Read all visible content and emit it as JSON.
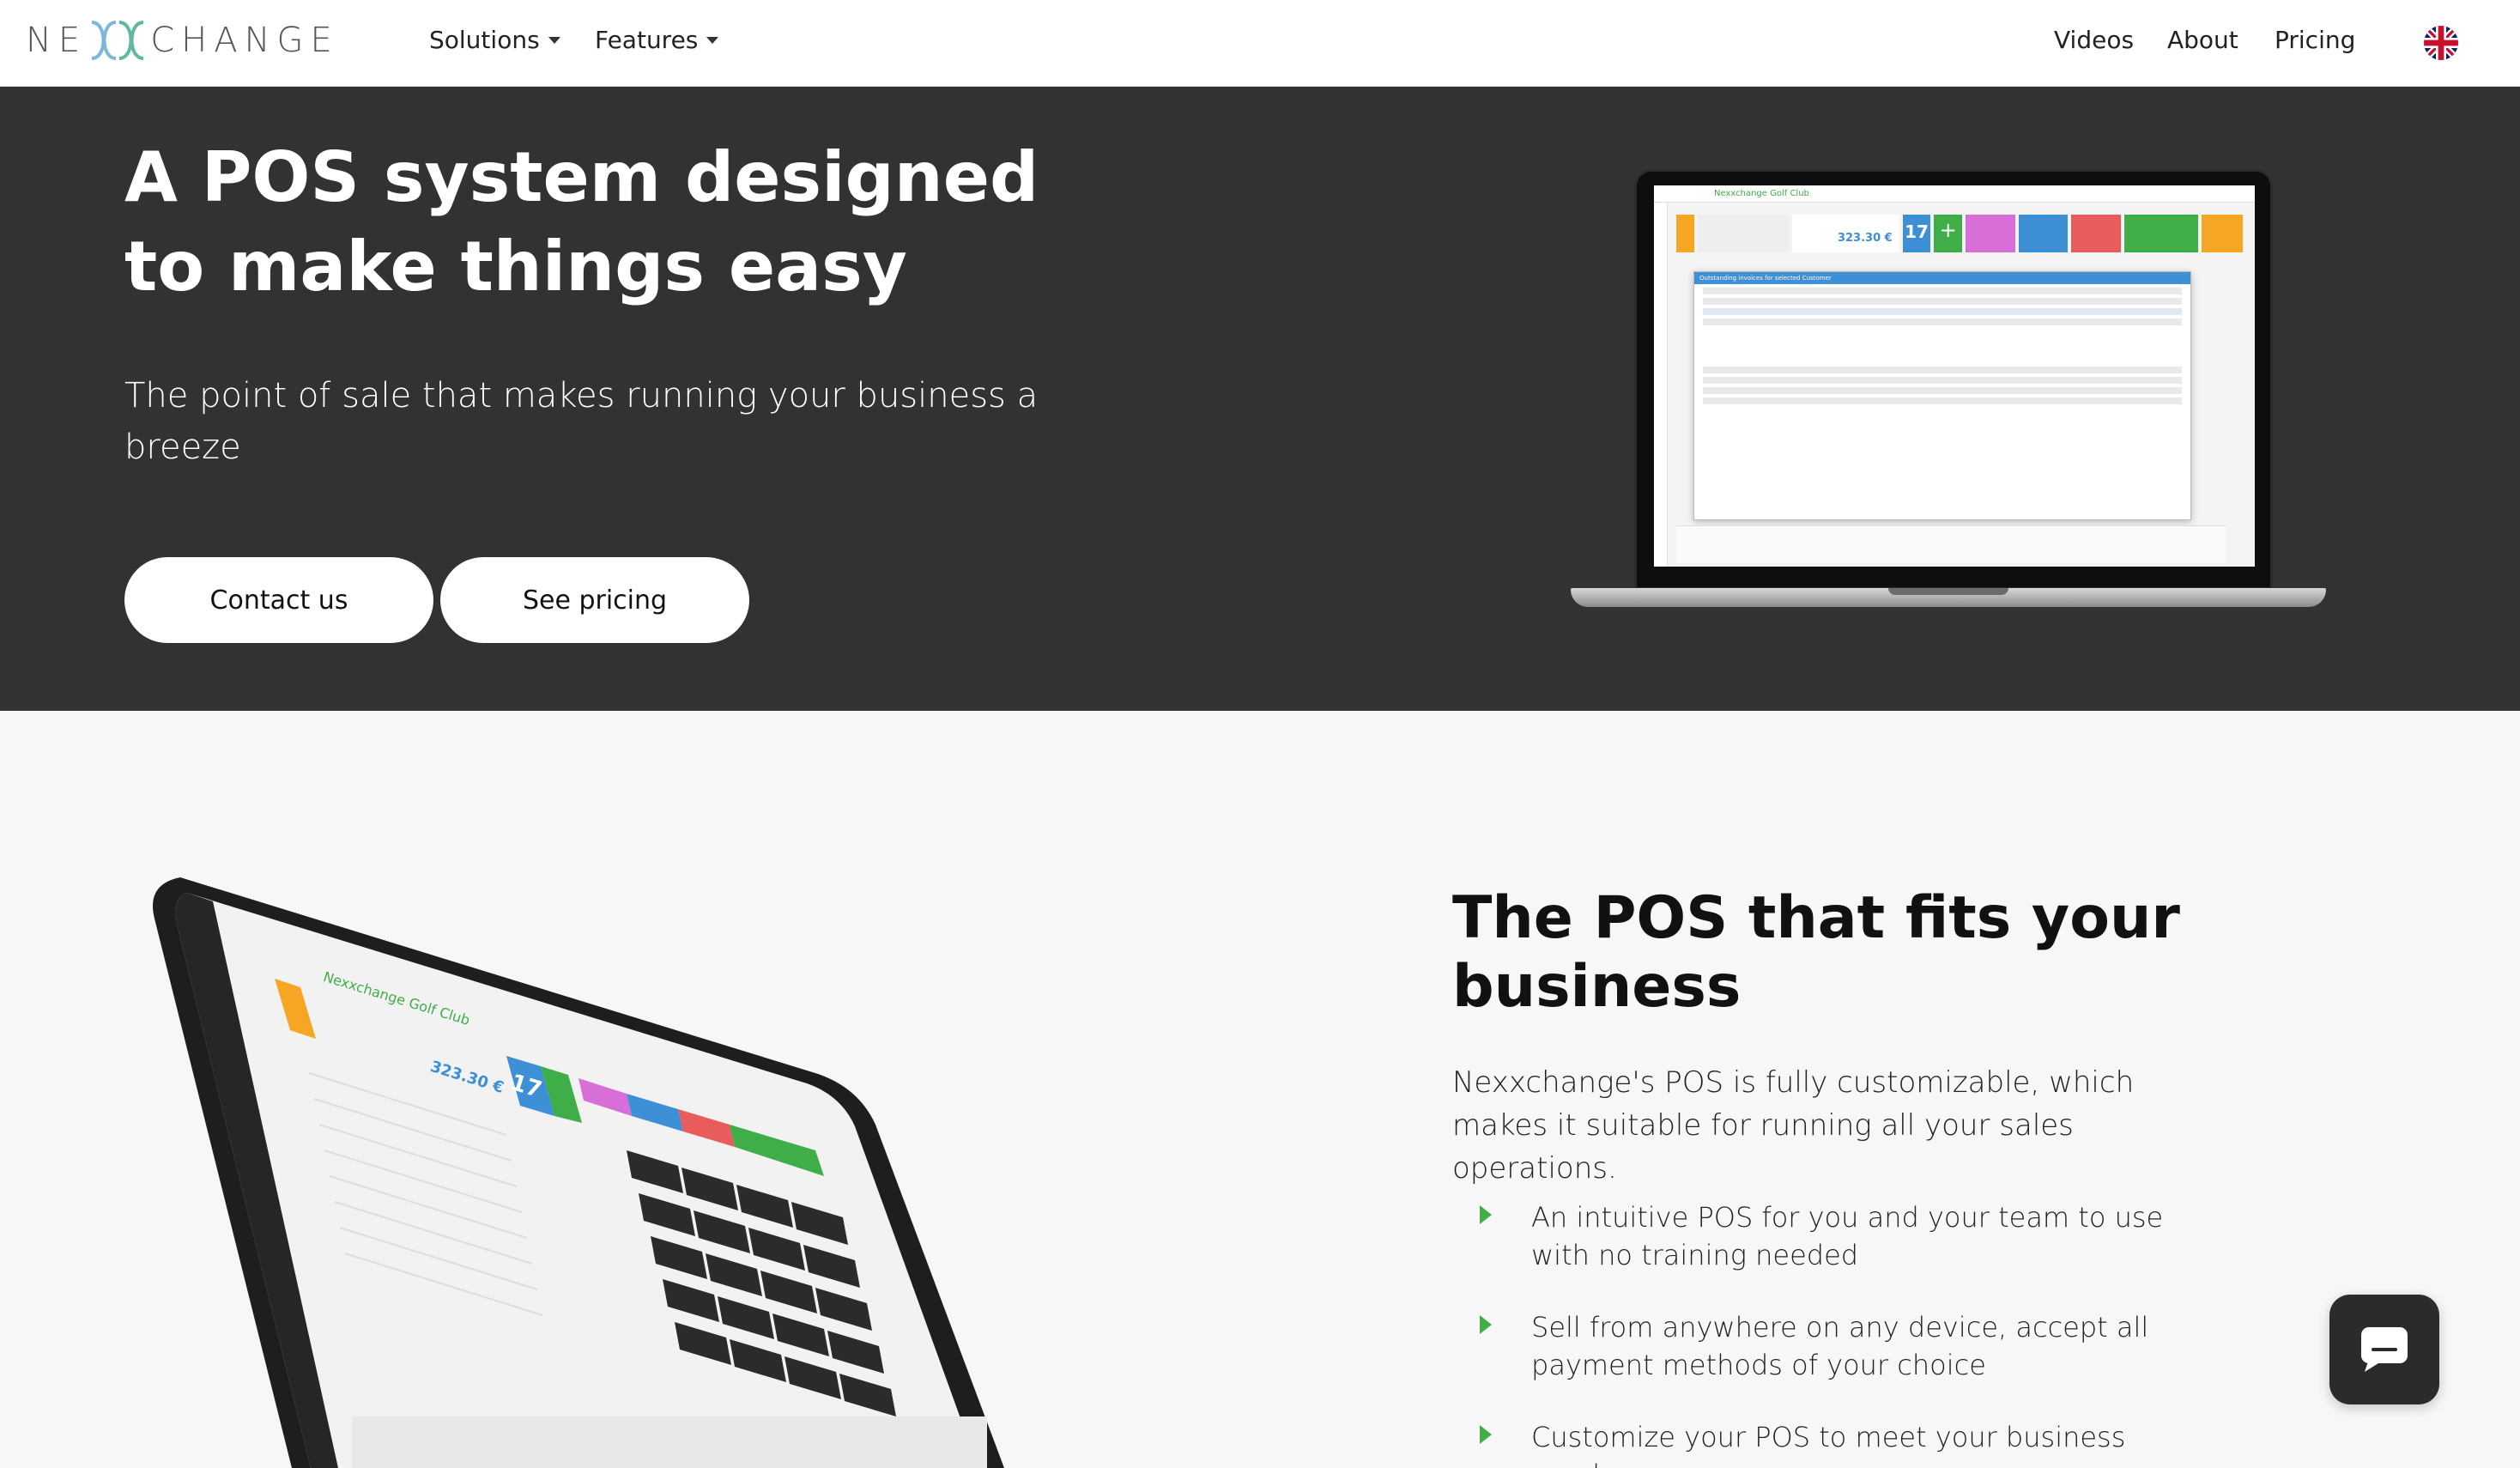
{
  "nav": {
    "logo_left": "NE",
    "logo_right": "CHANGE",
    "solutions": "Solutions",
    "features": "Features",
    "videos": "Videos",
    "about": "About",
    "pricing": "Pricing",
    "language_icon": "uk-flag-icon"
  },
  "hero": {
    "title_line1": "A POS system designed",
    "title_line2": "to make things easy",
    "subtitle": "The point of sale that makes running your business a breeze",
    "contact_button": "Contact us",
    "pricing_button": "See pricing",
    "laptop_app_name": "Nexxchange Golf Club",
    "laptop_amount": "323.30 €",
    "laptop_counter": "17",
    "laptop_modal_title": "Outstanding invoices for selected Customer"
  },
  "section2": {
    "title": "The POS that fits your business",
    "text": "Nexxchange's POS is fully customizable, which makes it suitable for running all your sales operations.",
    "bullets": [
      "An intuitive POS for you and your team to use with no training needed",
      "Sell from anywhere on any device, accept all payment methods of your choice",
      "Customize your POS to meet your business needs,"
    ],
    "tablet_app_name": "Nexxchange Golf Club",
    "tablet_amount": "323.30 €",
    "tablet_counter": "17"
  },
  "chat": {
    "icon": "chat-bubble-icon"
  },
  "colors": {
    "brand_green": "#3fae49",
    "hero_bg": "#333232",
    "page_bg": "#f7f7f9",
    "accent_blue": "#3d8fd6"
  }
}
